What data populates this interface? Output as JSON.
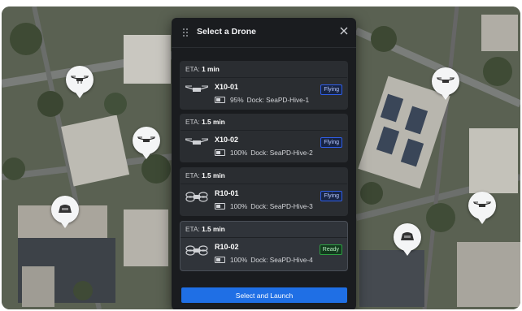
{
  "panel": {
    "title": "Select a Drone",
    "launch_label": "Select and Launch"
  },
  "drones": [
    {
      "eta_label": "ETA:",
      "eta_value": "1 min",
      "name": "X10-01",
      "battery": "95%",
      "dock": "Dock: SeaPD-Hive-1",
      "status": "Flying",
      "model": "X10"
    },
    {
      "eta_label": "ETA:",
      "eta_value": "1.5 min",
      "name": "X10-02",
      "battery": "100%",
      "dock": "Dock: SeaPD-Hive-2",
      "status": "Flying",
      "model": "X10"
    },
    {
      "eta_label": "ETA:",
      "eta_value": "1.5 min",
      "name": "R10-01",
      "battery": "100%",
      "dock": "Dock: SeaPD-Hive-3",
      "status": "Flying",
      "model": "R10"
    },
    {
      "eta_label": "ETA:",
      "eta_value": "1.5 min",
      "name": "R10-02",
      "battery": "100%",
      "dock": "Dock: SeaPD-Hive-4",
      "status": "Ready",
      "model": "R10"
    }
  ],
  "colors": {
    "accent": "#1f6fe5",
    "flying": "#2f5ee8",
    "ready": "#2ea043",
    "panel_bg": "#1a1c1f"
  }
}
